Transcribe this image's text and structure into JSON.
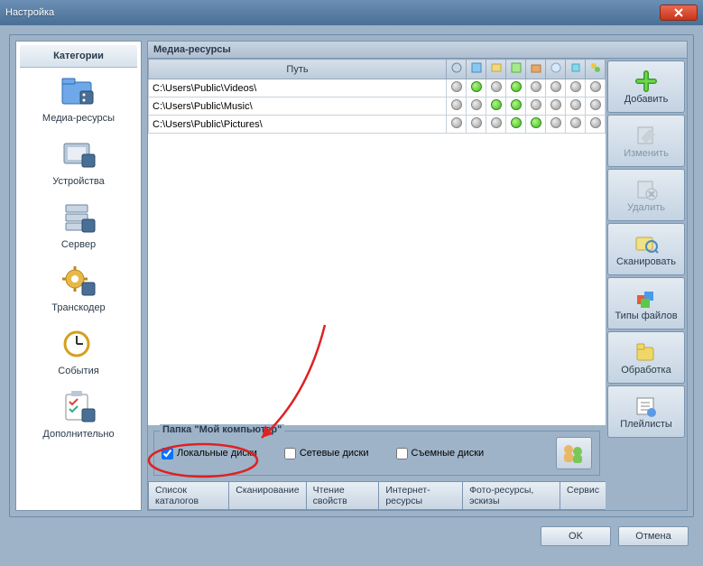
{
  "window": {
    "title": "Настройка"
  },
  "sidebar": {
    "tab_label": "Категории",
    "items": [
      {
        "label": "Медиа-ресурсы"
      },
      {
        "label": "Устройства"
      },
      {
        "label": "Сервер"
      },
      {
        "label": "Транскодер"
      },
      {
        "label": "События"
      },
      {
        "label": "Дополнительно"
      }
    ]
  },
  "content": {
    "title": "Медиа-ресурсы",
    "path_header": "Путь",
    "rows": [
      {
        "path": "C:\\Users\\Public\\Videos\\",
        "states": [
          "grey",
          "green",
          "grey",
          "green",
          "grey",
          "grey",
          "grey",
          "grey"
        ]
      },
      {
        "path": "C:\\Users\\Public\\Music\\",
        "states": [
          "grey",
          "grey",
          "green",
          "green",
          "grey",
          "grey",
          "grey",
          "grey"
        ]
      },
      {
        "path": "C:\\Users\\Public\\Pictures\\",
        "states": [
          "grey",
          "grey",
          "grey",
          "green",
          "green",
          "grey",
          "grey",
          "grey"
        ]
      }
    ]
  },
  "fieldset": {
    "legend": "Папка \"Мой компьютер\"",
    "checkboxes": [
      {
        "label": "Локальные диски",
        "checked": true
      },
      {
        "label": "Сетевые диски",
        "checked": false
      },
      {
        "label": "Съемные диски",
        "checked": false
      }
    ]
  },
  "tabs": [
    "Список каталогов",
    "Сканирование",
    "Чтение свойств",
    "Интернет-ресурсы",
    "Фото-ресурсы, эскизы",
    "Сервис"
  ],
  "toolbar": {
    "items": [
      {
        "label": "Добавить",
        "enabled": true,
        "icon": "plus"
      },
      {
        "label": "Изменить",
        "enabled": false,
        "icon": "edit"
      },
      {
        "label": "Удалить",
        "enabled": false,
        "icon": "delete"
      },
      {
        "label": "Сканировать",
        "enabled": true,
        "icon": "scan"
      },
      {
        "label": "Типы файлов",
        "enabled": true,
        "icon": "filetypes"
      },
      {
        "label": "Обработка",
        "enabled": true,
        "icon": "process"
      },
      {
        "label": "Плейлисты",
        "enabled": true,
        "icon": "playlists"
      }
    ]
  },
  "buttons": {
    "ok": "OK",
    "cancel": "Отмена"
  }
}
